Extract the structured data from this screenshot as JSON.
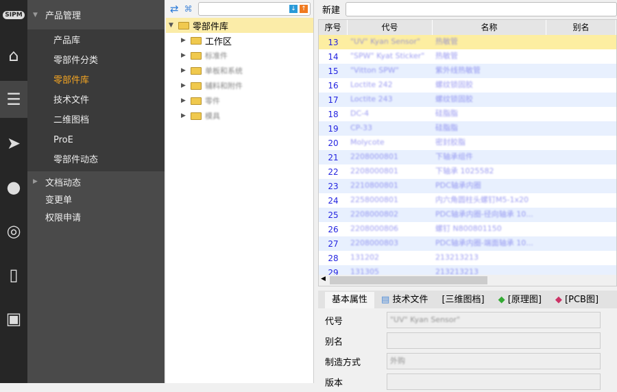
{
  "iconbar": {
    "logo_text": "SIPM",
    "items": [
      "home-icon",
      "database-icon",
      "send-icon",
      "chat-icon",
      "broadcast-icon",
      "book-icon",
      "id-card-icon"
    ]
  },
  "sidebar": {
    "group1": "产品管理",
    "sub": [
      "产品库",
      "零部件分类",
      "零部件库",
      "技术文件",
      "二维图档",
      "ProE",
      "零部件动态"
    ],
    "active_index": 2,
    "group2": "文档动态",
    "items": [
      "变更单",
      "权限申请"
    ]
  },
  "tree": {
    "search_placeholder": "",
    "root": "零部件库",
    "children": [
      "工作区",
      "标准件",
      "单板和系统",
      "辅料和附件",
      "零件",
      "模具"
    ]
  },
  "toolbar": {
    "new_label": "新建",
    "input_value": ""
  },
  "grid": {
    "headers": [
      "序号",
      "代号",
      "名称",
      "别名"
    ],
    "rows": [
      {
        "no": "13",
        "code": "\"UV\" Kyan Sensor\"",
        "name": "热敏管"
      },
      {
        "no": "14",
        "code": "\"SPW\" Kyat Sticker\"",
        "name": "热敏管"
      },
      {
        "no": "15",
        "code": "\"Vitton SPW\"",
        "name": "紫外线热敏管"
      },
      {
        "no": "16",
        "code": "Loctite 242",
        "name": "螺纹锁固胶"
      },
      {
        "no": "17",
        "code": "Loctite 243",
        "name": "螺纹锁固胶"
      },
      {
        "no": "18",
        "code": "DC-4",
        "name": "硅脂脂"
      },
      {
        "no": "19",
        "code": "CP-33",
        "name": "硅脂脂"
      },
      {
        "no": "20",
        "code": "Molycote",
        "name": "密封胶脂"
      },
      {
        "no": "21",
        "code": "2208000801",
        "name": "下轴承组件"
      },
      {
        "no": "22",
        "code": "2208000801",
        "name": "下轴承 1025582"
      },
      {
        "no": "23",
        "code": "2210800801",
        "name": "PDC轴承内圈"
      },
      {
        "no": "24",
        "code": "2258000801",
        "name": "内六角圆柱头螺钉M5-1x20"
      },
      {
        "no": "25",
        "code": "2208000802",
        "name": "PDC轴承内圈-径向轴承 10..."
      },
      {
        "no": "26",
        "code": "2208000806",
        "name": "螺钉 N800801150"
      },
      {
        "no": "27",
        "code": "2208000803",
        "name": "PDC轴承内圈-端面轴承 10..."
      },
      {
        "no": "28",
        "code": "131202",
        "name": "213213213"
      },
      {
        "no": "29",
        "code": "131305",
        "name": "213213213"
      }
    ]
  },
  "tabs": [
    "基本属性",
    "技术文件",
    "[三维图档]",
    "[原理图]",
    "[PCB图]"
  ],
  "form": {
    "fields": [
      {
        "label": "代号",
        "value": "\"UV\" Kyan Sensor\""
      },
      {
        "label": "别名",
        "value": ""
      },
      {
        "label": "制造方式",
        "value": "外购"
      },
      {
        "label": "版本",
        "value": ""
      }
    ]
  }
}
